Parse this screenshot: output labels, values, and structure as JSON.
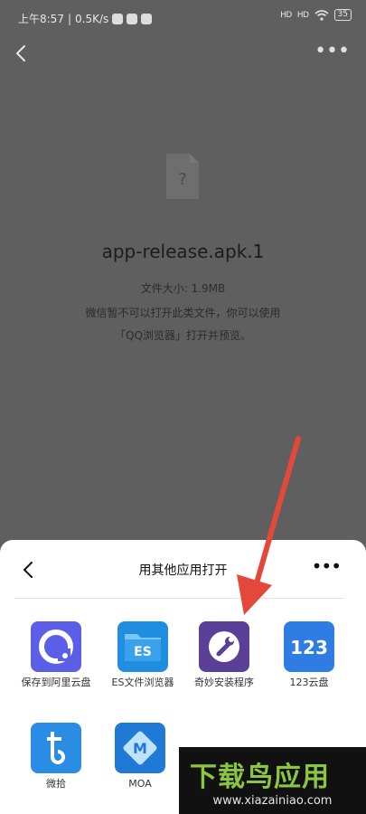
{
  "status_bar": {
    "time": "上午8:57",
    "speed": "0.5K/s",
    "signal1": "HD",
    "signal2": "HD",
    "battery": "35"
  },
  "file": {
    "name": "app-release.apk.1",
    "size_line": "文件大小: 1.9MB",
    "tip_line1": "微信暂不可以打开此类文件，你可以使用",
    "tip_line2": "「QQ浏览器」打开并预览。"
  },
  "sheet": {
    "title": "用其他应用打开",
    "apps": [
      {
        "label": "保存到阿里云盘",
        "icon": "aliyun-drive-icon",
        "color": "#5b5fe8"
      },
      {
        "label": "ES文件浏览器",
        "icon": "es-file-explorer-icon",
        "color": "#1f8ee0"
      },
      {
        "label": "奇妙安装程序",
        "icon": "wrench-icon",
        "color": "#5a3f97"
      },
      {
        "label": "123云盘",
        "icon": "123-cloud-icon",
        "color": "#2f7de3"
      },
      {
        "label": "微拾",
        "icon": "weishi-icon",
        "color": "#2a8de3"
      },
      {
        "label": "MOA",
        "icon": "moa-icon",
        "color": "#1f7ad6"
      }
    ]
  },
  "watermark": {
    "logo": "下载鸟应用",
    "url": "www.xiazainiao.com"
  },
  "colors": {
    "overlay": "#5f5f5f",
    "arrow": "#e4483a",
    "watermark_green": "#8cc63f"
  }
}
